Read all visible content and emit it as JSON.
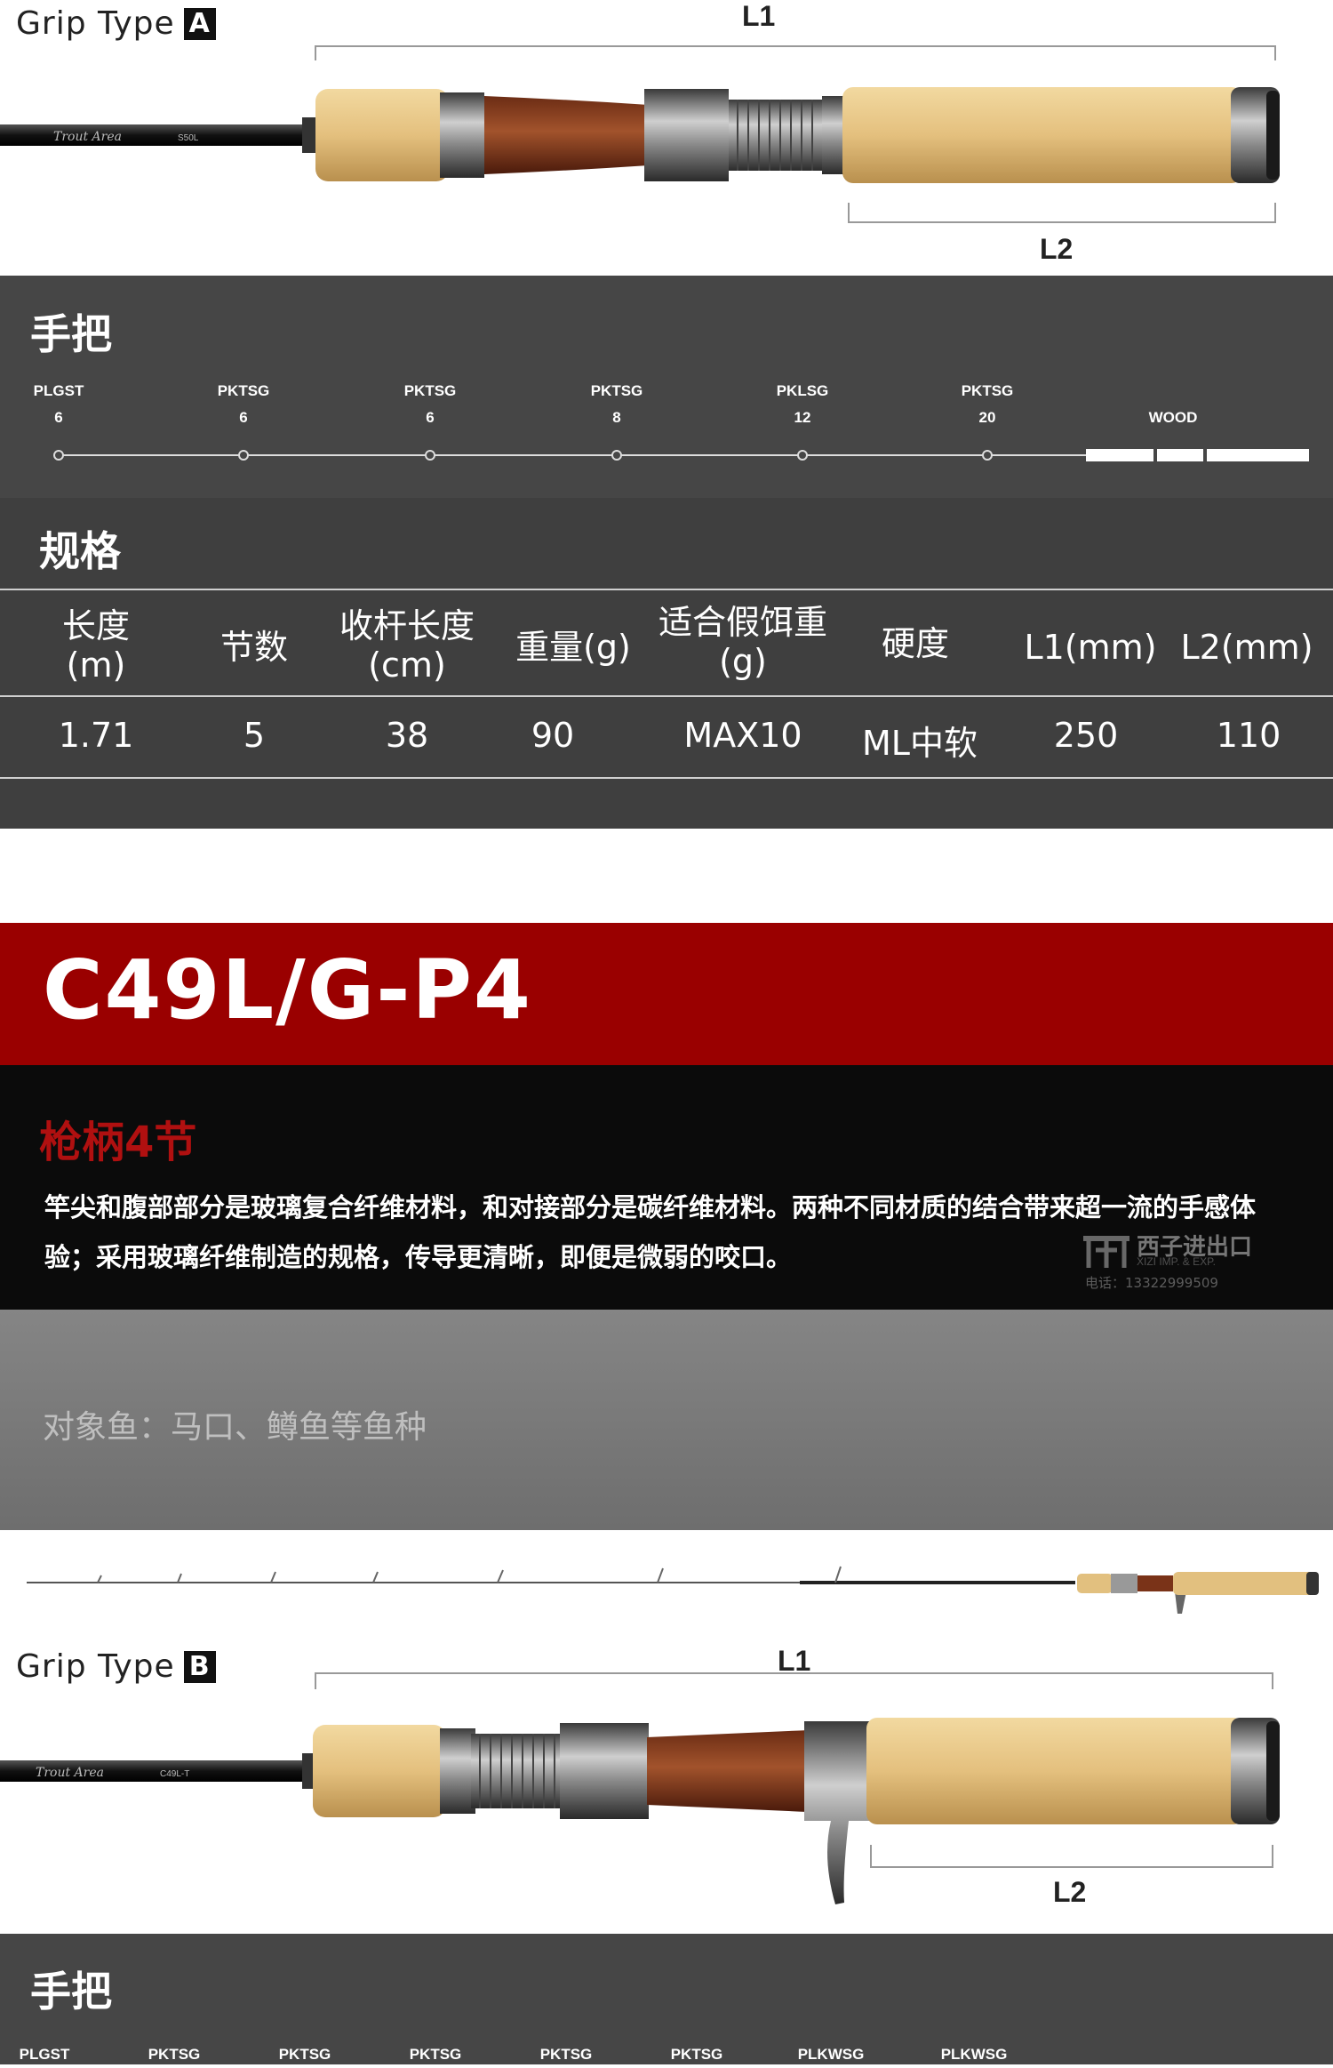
{
  "colors": {
    "dark": "#464646",
    "spec_bg": "#3e3e3e",
    "red": "#9a0000",
    "black": "#0b0b0b",
    "gray": "#7a7a7a",
    "cork": "#dcb878"
  },
  "grip_a": {
    "title": "Grip Type",
    "letter": "A",
    "l1": "L1",
    "l2": "L2",
    "rod_text": "Trout Area",
    "rod_model": "S50L"
  },
  "handle_section": {
    "title": "手把",
    "guides": [
      {
        "name": "PLGST",
        "size": "6"
      },
      {
        "name": "PKTSG",
        "size": "6"
      },
      {
        "name": "PKTSG",
        "size": "6"
      },
      {
        "name": "PKTSG",
        "size": "8"
      },
      {
        "name": "PKLSG",
        "size": "12"
      },
      {
        "name": "PKTSG",
        "size": "20"
      }
    ],
    "wood": "WOOD"
  },
  "spec_section": {
    "title": "规格",
    "headers": [
      "长度\n(m)",
      "节数",
      "收杆长度\n(cm)",
      "重量(g)",
      "适合假饵重\n(g)",
      "硬度",
      "L1(mm)",
      "L2(mm)"
    ],
    "values": [
      "1.71",
      "5",
      "38",
      "90",
      "MAX10",
      "ML中软",
      "250",
      "110"
    ]
  },
  "model": {
    "name": "C49L/G-P4"
  },
  "description": {
    "subtitle": "枪柄4节",
    "text": "竿尖和腹部部分是玻璃复合纤维材料，和对接部分是碳纤维材料。两种不同材质的结合带来超一流的手感体验；采用玻璃纤维制造的规格，传导更清晰，即便是微弱的咬口。",
    "watermark_cn": "西子进出口",
    "watermark_en": "XIZI IMP. & EXP.",
    "watermark_phone": "电话：13322999509"
  },
  "target": {
    "text": "对象鱼：马口、鳟鱼等鱼种"
  },
  "grip_b": {
    "title": "Grip Type",
    "letter": "B",
    "l1": "L1",
    "l2": "L2",
    "rod_text": "Trout Area",
    "rod_model": "C49L-T"
  },
  "handle_section_b": {
    "title": "手把",
    "guides": [
      "PLGST",
      "PKTSG",
      "PKTSG",
      "PKTSG",
      "PKTSG",
      "PKTSG",
      "PLKWSG",
      "PLKWSG"
    ]
  }
}
